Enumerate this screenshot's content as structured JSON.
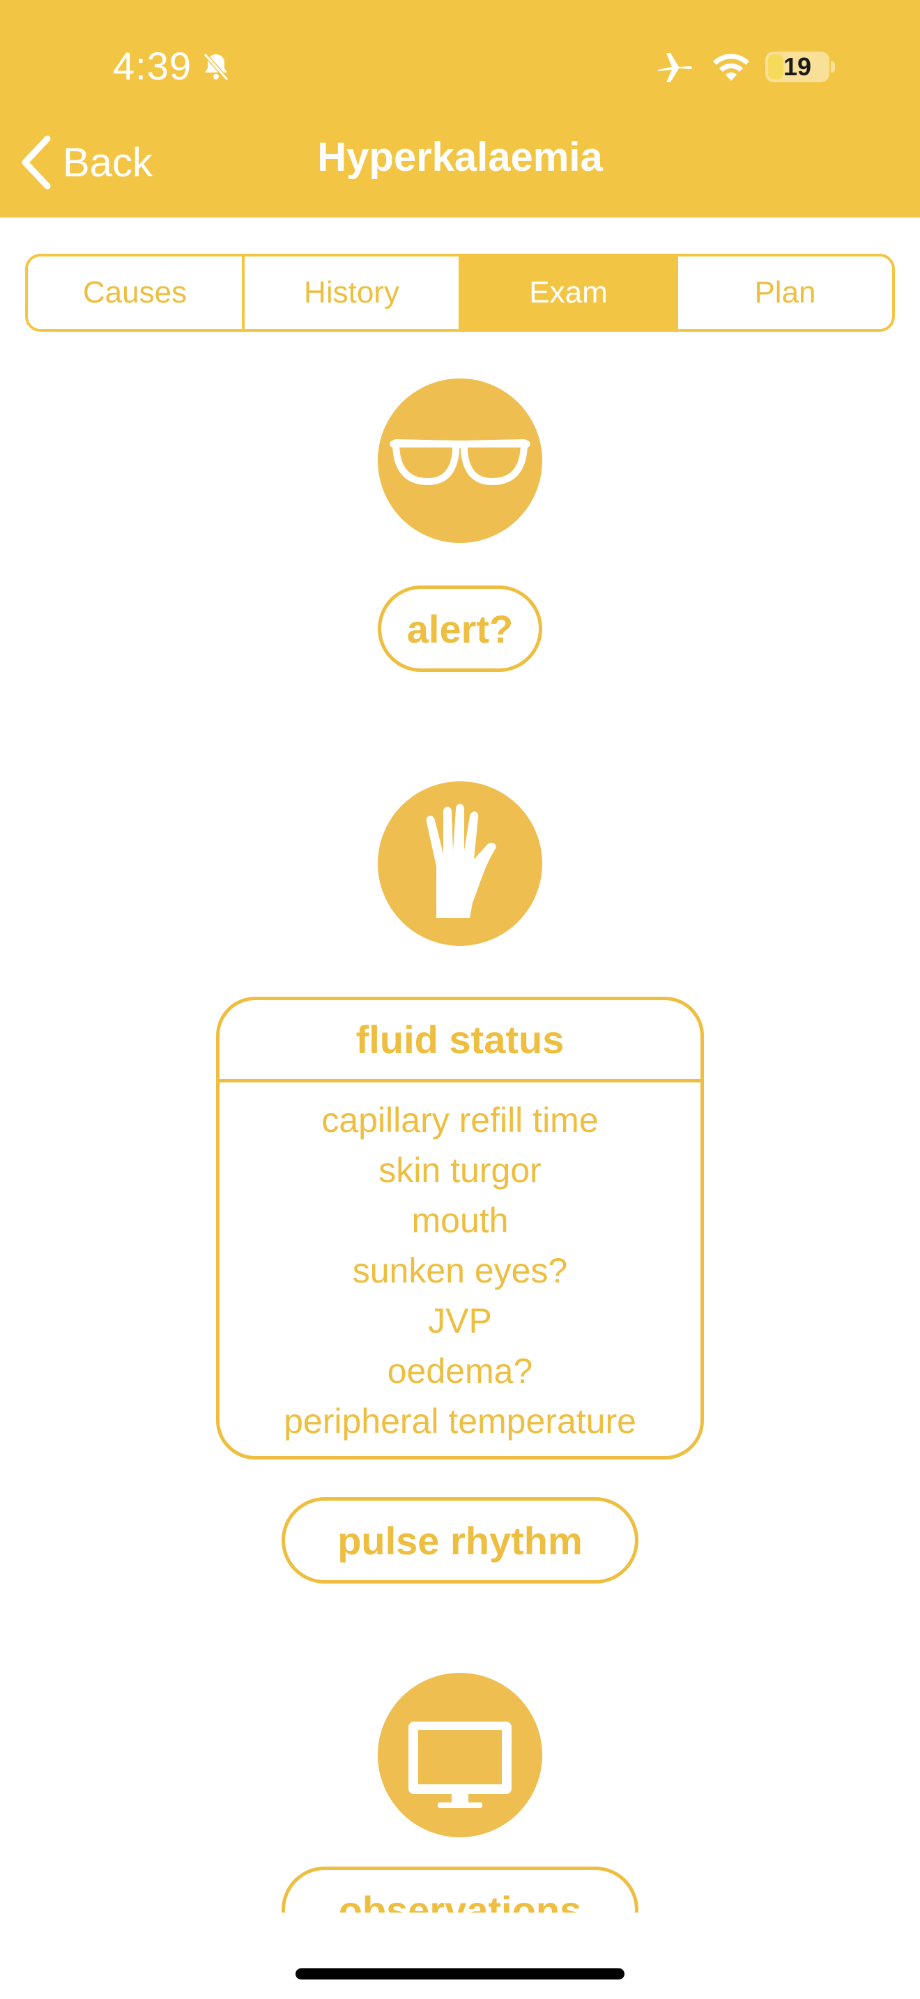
{
  "status_bar": {
    "time": "4:39",
    "battery": "19"
  },
  "nav": {
    "back_label": "Back",
    "title": "Hyperkalaemia"
  },
  "tabs": [
    {
      "label": "Causes",
      "active": false
    },
    {
      "label": "History",
      "active": false
    },
    {
      "label": "Exam",
      "active": true
    },
    {
      "label": "Plan",
      "active": false
    }
  ],
  "sections": {
    "look": {
      "icon": "glasses-icon",
      "button_label": "alert?"
    },
    "feel": {
      "icon": "hand-icon",
      "card_title": "fluid status",
      "card_items": [
        "capillary refill time",
        "skin turgor",
        "mouth",
        "sunken eyes?",
        "JVP",
        "oedema?",
        "peripheral temperature"
      ],
      "button_label": "pulse rhythm"
    },
    "monitor": {
      "icon": "monitor-icon",
      "button_label": "observations"
    }
  },
  "colors": {
    "header": "#F2C644",
    "accent": "#EDBE3F",
    "icon_circle": "#EEBF50"
  }
}
